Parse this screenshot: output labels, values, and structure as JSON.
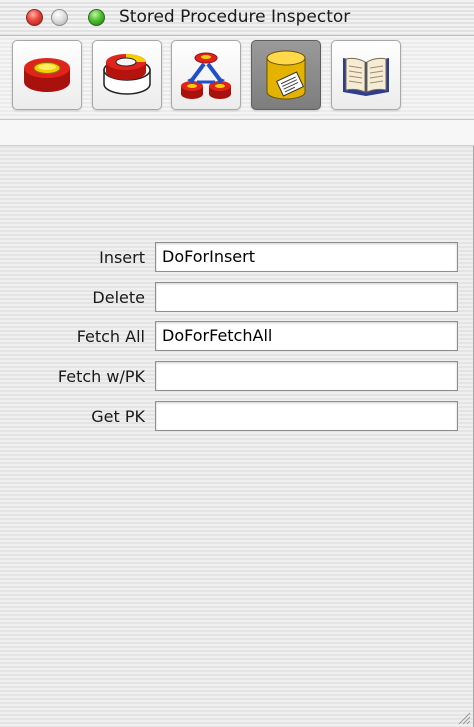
{
  "window": {
    "title": "Stored Procedure Inspector"
  },
  "toolbar": {
    "buttons": [
      {
        "icon": "entity-inspector-icon",
        "selected": false
      },
      {
        "icon": "attributes-inspector-icon",
        "selected": false
      },
      {
        "icon": "relationship-inspector-icon",
        "selected": false
      },
      {
        "icon": "stored-procedure-inspector-icon",
        "selected": true
      },
      {
        "icon": "documentation-book-icon",
        "selected": false
      }
    ]
  },
  "form": {
    "rows": [
      {
        "label": "Insert",
        "value": "DoForInsert"
      },
      {
        "label": "Delete",
        "value": ""
      },
      {
        "label": "Fetch All",
        "value": "DoForFetchAll"
      },
      {
        "label": "Fetch w/PK",
        "value": ""
      },
      {
        "label": "Get PK",
        "value": ""
      }
    ]
  }
}
